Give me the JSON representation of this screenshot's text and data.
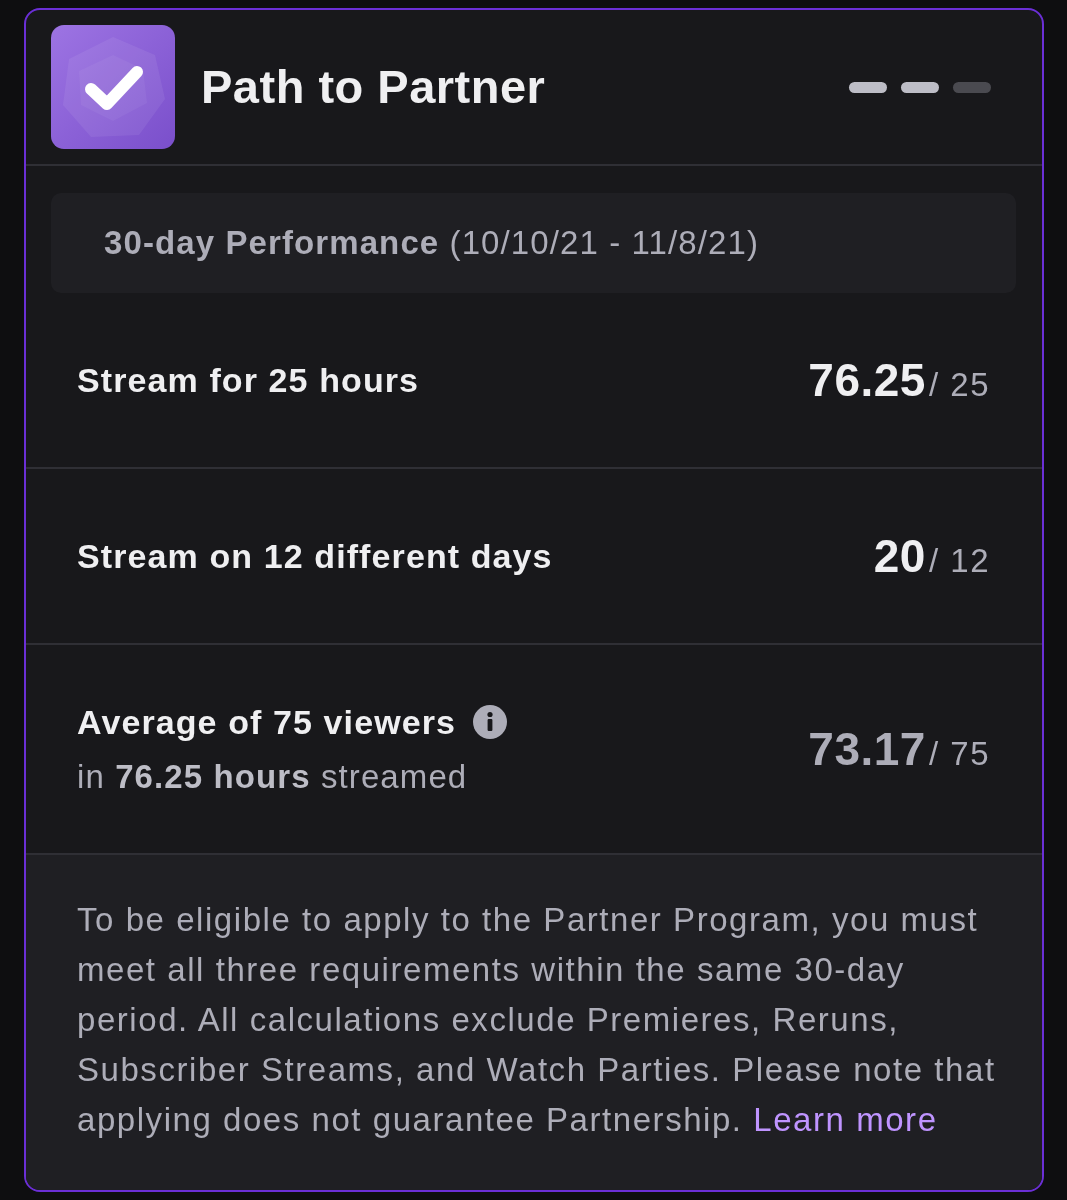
{
  "header": {
    "title": "Path to Partner",
    "progress_steps": [
      {
        "filled": true
      },
      {
        "filled": true
      },
      {
        "filled": false
      }
    ]
  },
  "period": {
    "text": "**30-day Performance** (10/10/21 - 11/8/21)"
  },
  "requirements": [
    {
      "label": "Stream for 25 hours",
      "value": "76.25",
      "target": "/ 25",
      "met": true
    },
    {
      "label": "Stream on 12 different days",
      "value": "20",
      "target": "/ 12",
      "met": true
    },
    {
      "label": "Average of 75 viewers",
      "info": true,
      "detail": "in **76.25 hours** streamed",
      "value": "73.17",
      "target": "/ 75",
      "met": false
    }
  ],
  "footer": {
    "text": "To be eligible to apply to the Partner Program, you must meet all three requirements within the same 30-day period. All calculations exclude Premieres, Reruns, Subscriber Streams, and Watch Parties. Please note that applying does not guarantee Partnership.",
    "link": "Learn more"
  }
}
